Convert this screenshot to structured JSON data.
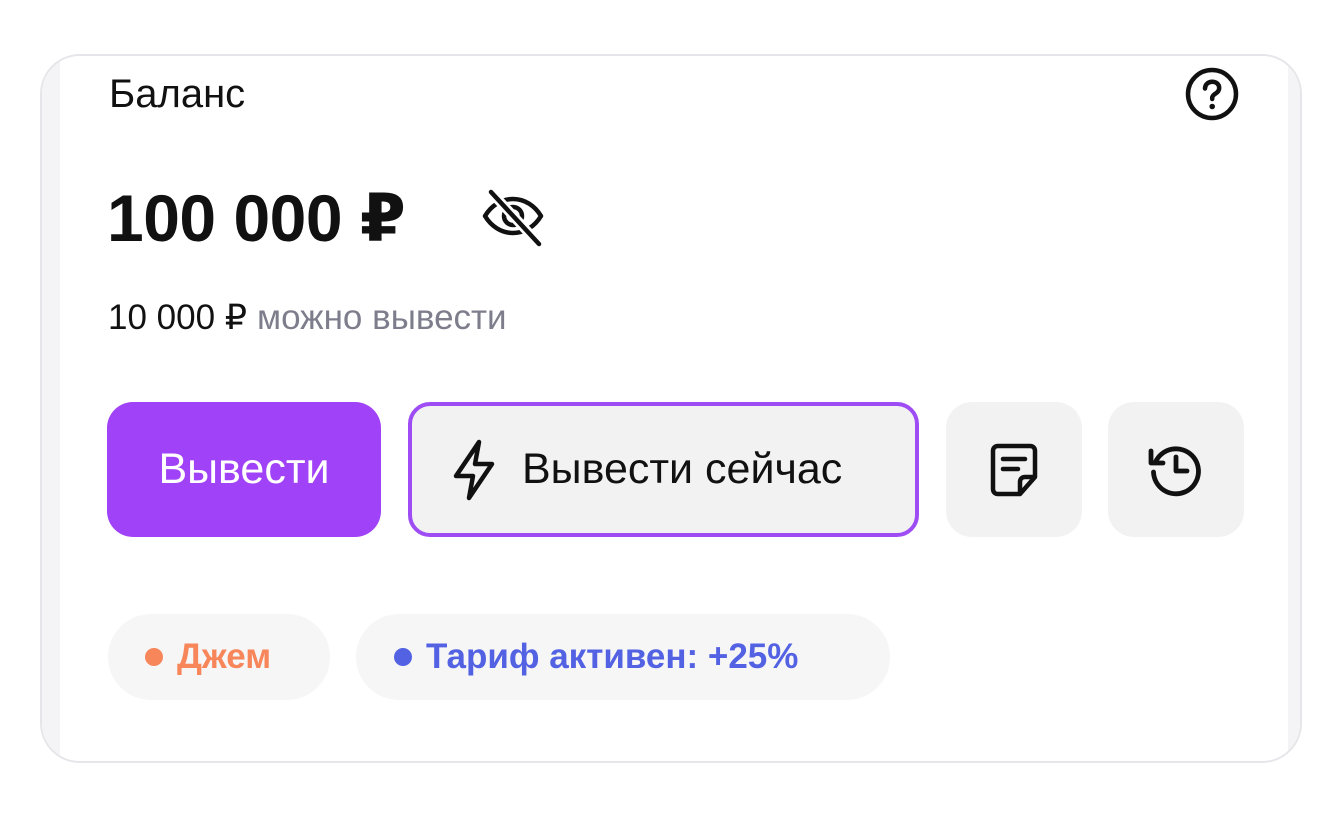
{
  "balance": {
    "title": "Баланс",
    "amount": "100 000 ₽",
    "withdrawable_value": "10 000 ₽",
    "withdrawable_hint": "можно вывести",
    "help_icon": "question-circle-icon",
    "visibility_icon": "eye-off-icon"
  },
  "actions": {
    "withdraw_label": "Вывести",
    "withdraw_now_label": "Вывести сейчас",
    "withdraw_now_icon": "lightning-icon",
    "receipts_icon": "document-icon",
    "history_icon": "history-icon"
  },
  "badges": {
    "jam_label": "Джем",
    "tariff_label": "Тариф активен: +25%"
  },
  "colors": {
    "primary": "#a042f7",
    "instant_border": "#9e4cf3",
    "jam": "#f7865a",
    "tariff": "#5362e3",
    "muted_text": "#7d7d8c"
  }
}
